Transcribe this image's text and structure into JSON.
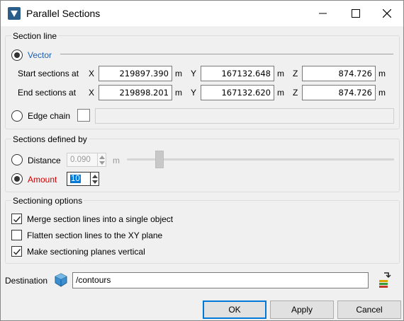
{
  "window": {
    "title": "Parallel Sections"
  },
  "section_line": {
    "group_title": "Section line",
    "vector_label": "Vector",
    "start_label": "Start sections at",
    "end_label": "End sections at",
    "axis_x": "X",
    "axis_y": "Y",
    "axis_z": "Z",
    "unit": "m",
    "start": {
      "x": "219897.390",
      "y": "167132.648",
      "z": "874.726"
    },
    "end": {
      "x": "219898.201",
      "y": "167132.620",
      "z": "874.726"
    },
    "edge_chain_label": "Edge chain",
    "edge_chain_value": ""
  },
  "sections_defined_by": {
    "group_title": "Sections defined by",
    "distance_label": "Distance",
    "distance_value": "0.090",
    "distance_unit": "m",
    "amount_label": "Amount",
    "amount_value": "10",
    "selected": "amount"
  },
  "sectioning_options": {
    "group_title": "Sectioning options",
    "merge_label": "Merge section lines into a single object",
    "merge_checked": true,
    "flatten_label": "Flatten section lines to the XY plane",
    "flatten_checked": false,
    "vertical_label": "Make sectioning planes vertical",
    "vertical_checked": true
  },
  "destination": {
    "label": "Destination",
    "value": "/contours"
  },
  "buttons": {
    "ok": "OK",
    "apply": "Apply",
    "cancel": "Cancel"
  },
  "colors": {
    "accent_blue": "#0078d7",
    "vector_label_blue": "#1a5fb4",
    "amount_label_red": "#cc0000",
    "icon_cube": "#2e86c1"
  }
}
